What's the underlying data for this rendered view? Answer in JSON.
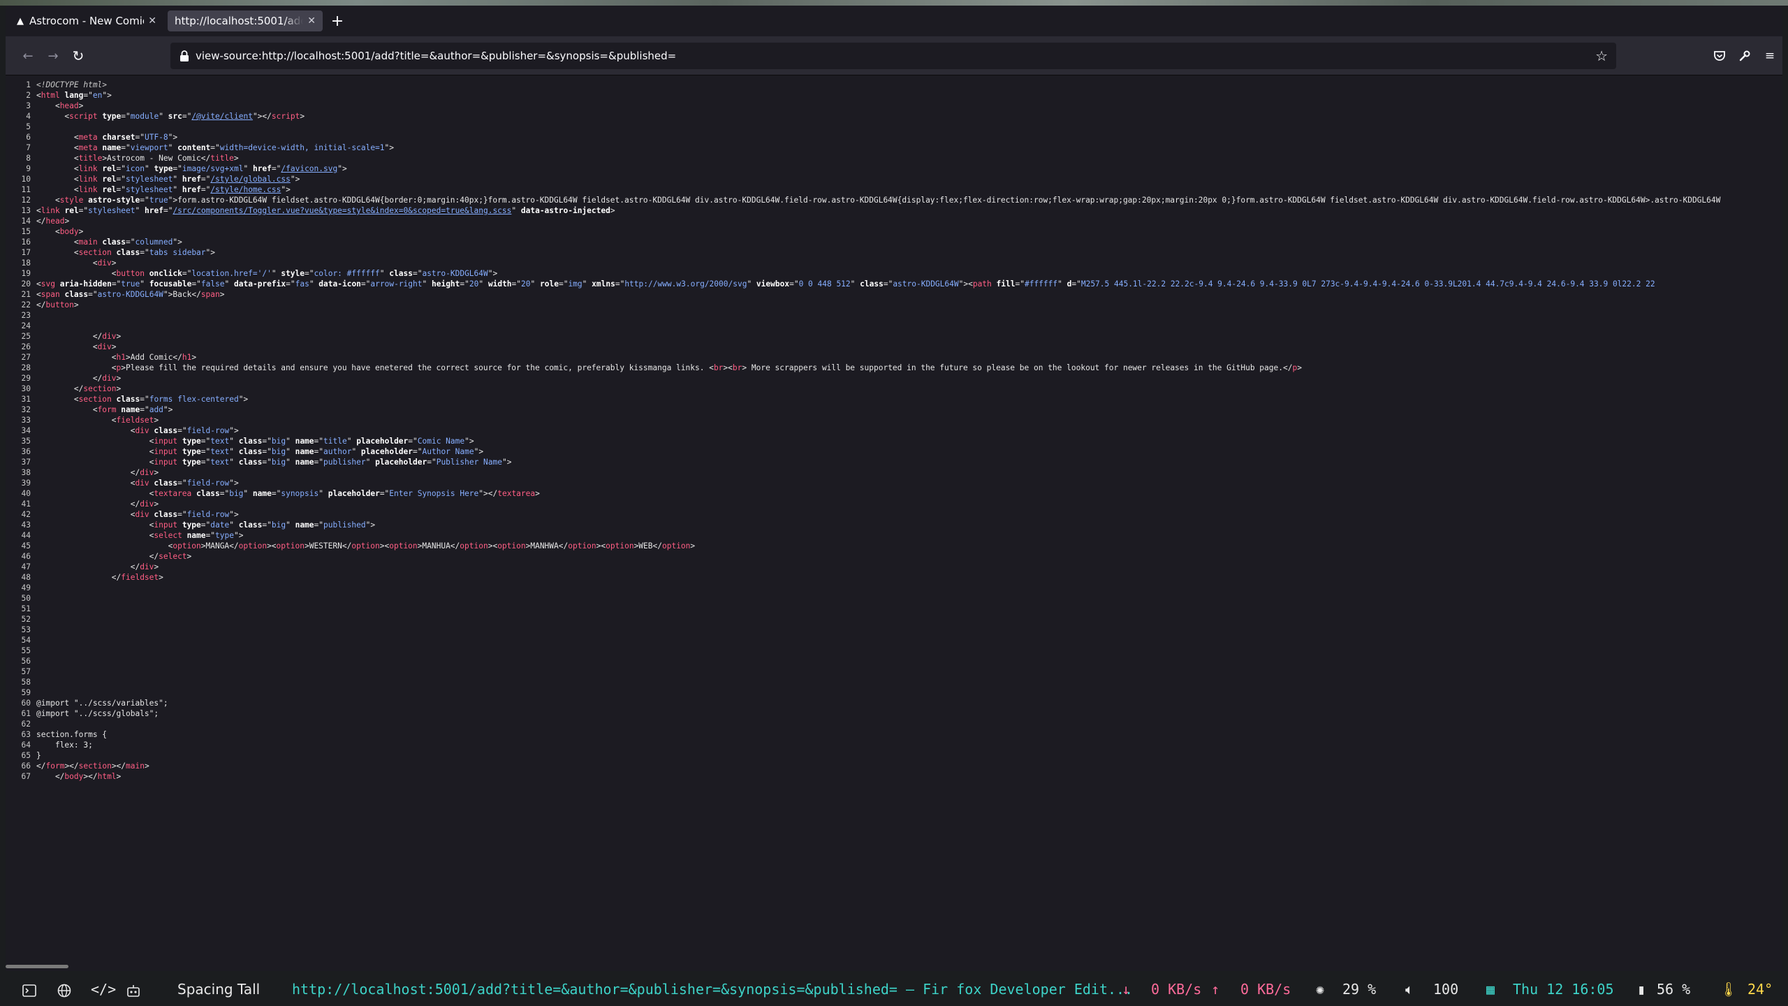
{
  "browser": {
    "tabs": [
      {
        "title": "Astrocom - New Comic",
        "favicon": "astro-logo-icon",
        "active": false
      },
      {
        "title": "http://localhost:5001/add?title=&author=&publisher=&synopsis=&published=",
        "favicon": "",
        "active": true
      }
    ],
    "url": "view-source:http://localhost:5001/add?title=&author=&publisher=&synopsis=&published=",
    "icons": [
      "back-icon",
      "forward-icon",
      "reload-icon",
      "lock-icon",
      "bookmark-star-icon",
      "pocket-icon",
      "devtools-icon",
      "menu-icon"
    ]
  },
  "source": {
    "lines": [
      {
        "n": 1,
        "html": "<span class=\"doc\">&lt;!DOCTYPE html&gt;</span>"
      },
      {
        "n": 2,
        "html": "&lt;<span class=\"tg\">html</span> <span class=\"a\">lang</span>=\"<span class=\"v\">en</span>\"&gt;"
      },
      {
        "n": 3,
        "html": "    &lt;<span class=\"tg\">head</span>&gt;"
      },
      {
        "n": 4,
        "html": "      &lt;<span class=\"tg\">script</span> <span class=\"a\">type</span>=\"<span class=\"v\">module</span>\" <span class=\"a\">src</span>=\"<span class=\"lnk\">/@vite/client</span>\"&gt;&lt;/<span class=\"tg\">script</span>&gt;"
      },
      {
        "n": 5,
        "html": ""
      },
      {
        "n": 6,
        "html": "        &lt;<span class=\"tg\">meta</span> <span class=\"a\">charset</span>=\"<span class=\"v\">UTF-8</span>\"&gt;"
      },
      {
        "n": 7,
        "html": "        &lt;<span class=\"tg\">meta</span> <span class=\"a\">name</span>=\"<span class=\"v\">viewport</span>\" <span class=\"a\">content</span>=\"<span class=\"v\">width=device-width, initial-scale=1</span>\"&gt;"
      },
      {
        "n": 8,
        "html": "        &lt;<span class=\"tg\">title</span>&gt;Astrocom - New Comic&lt;/<span class=\"tg\">title</span>&gt;"
      },
      {
        "n": 9,
        "html": "        &lt;<span class=\"tg\">link</span> <span class=\"a\">rel</span>=\"<span class=\"v\">icon</span>\" <span class=\"a\">type</span>=\"<span class=\"v\">image/svg+xml</span>\" <span class=\"a\">href</span>=\"<span class=\"lnk\">/favicon.svg</span>\"&gt;"
      },
      {
        "n": 10,
        "html": "        &lt;<span class=\"tg\">link</span> <span class=\"a\">rel</span>=\"<span class=\"v\">stylesheet</span>\" <span class=\"a\">href</span>=\"<span class=\"lnk\">/style/global.css</span>\"&gt;"
      },
      {
        "n": 11,
        "html": "        &lt;<span class=\"tg\">link</span> <span class=\"a\">rel</span>=\"<span class=\"v\">stylesheet</span>\" <span class=\"a\">href</span>=\"<span class=\"lnk\">/style/home.css</span>\"&gt;"
      },
      {
        "n": 12,
        "html": "    &lt;<span class=\"tg\">style</span> <span class=\"a\">astro-style</span>=\"<span class=\"v\">true</span>\"&gt;form.astro-KDDGL64W fieldset.astro-KDDGL64W{border:0;margin:40px;}form.astro-KDDGL64W fieldset.astro-KDDGL64W div.astro-KDDGL64W.field-row.astro-KDDGL64W{display:flex;flex-direction:row;flex-wrap:wrap;gap:20px;margin:20px 0;}form.astro-KDDGL64W fieldset.astro-KDDGL64W div.astro-KDDGL64W.field-row.astro-KDDGL64W&gt;.astro-KDDGL64W"
      },
      {
        "n": 13,
        "html": "&lt;<span class=\"tg\">link</span> <span class=\"a\">rel</span>=\"<span class=\"v\">stylesheet</span>\" <span class=\"a\">href</span>=\"<span class=\"lnk\">/src/components/Toggler.vue?vue&amp;type=style&amp;index=0&amp;scoped=true&amp;lang.scss</span>\" <span class=\"a\">data-astro-injected</span>&gt;"
      },
      {
        "n": 14,
        "html": "&lt;/<span class=\"tg\">head</span>&gt;"
      },
      {
        "n": 15,
        "html": "    &lt;<span class=\"tg\">body</span>&gt;"
      },
      {
        "n": 16,
        "html": "        &lt;<span class=\"tg\">main</span> <span class=\"a\">class</span>=\"<span class=\"v\">columned</span>\"&gt;"
      },
      {
        "n": 17,
        "html": "        &lt;<span class=\"tg\">section</span> <span class=\"a\">class</span>=\"<span class=\"v\">tabs sidebar</span>\"&gt;"
      },
      {
        "n": 18,
        "html": "            &lt;<span class=\"tg\">div</span>&gt;"
      },
      {
        "n": 19,
        "html": "                &lt;<span class=\"tg\">button</span> <span class=\"a\">onclick</span>=\"<span class=\"v\">location.href='/'</span>\" <span class=\"a\">style</span>=\"<span class=\"v\">color: #ffffff</span>\" <span class=\"a\">class</span>=\"<span class=\"v\">astro-KDDGL64W</span>\"&gt;"
      },
      {
        "n": 20,
        "html": "&lt;<span class=\"tg\">svg</span> <span class=\"a\">aria-hidden</span>=\"<span class=\"v\">true</span>\" <span class=\"a\">focusable</span>=\"<span class=\"v\">false</span>\" <span class=\"a\">data-prefix</span>=\"<span class=\"v\">fas</span>\" <span class=\"a\">data-icon</span>=\"<span class=\"v\">arrow-right</span>\" <span class=\"a\">height</span>=\"<span class=\"v\">20</span>\" <span class=\"a\">width</span>=\"<span class=\"v\">20</span>\" <span class=\"a\">role</span>=\"<span class=\"v\">img</span>\" <span class=\"a\">xmlns</span>=\"<span class=\"v\">http://www.w3.org/2000/svg</span>\" <span class=\"a\">viewbox</span>=\"<span class=\"v\">0 0 448 512</span>\" <span class=\"a\">class</span>=\"<span class=\"v\">astro-KDDGL64W</span>\"&gt;&lt;<span class=\"tg\">path</span> <span class=\"a\">fill</span>=\"<span class=\"v\">#ffffff</span>\" <span class=\"a\">d</span>=\"<span class=\"v\">M257.5 445.1l-22.2 22.2c-9.4 9.4-24.6 9.4-33.9 0L7 273c-9.4-9.4-9.4-24.6 0-33.9L201.4 44.7c9.4-9.4 24.6-9.4 33.9 0l22.2 22</span>"
      },
      {
        "n": 21,
        "html": "&lt;<span class=\"tg\">span</span> <span class=\"a\">class</span>=\"<span class=\"v\">astro-KDDGL64W</span>\"&gt;Back&lt;/<span class=\"tg\">span</span>&gt;"
      },
      {
        "n": 22,
        "html": "&lt;/<span class=\"tg\">button</span>&gt;"
      },
      {
        "n": 23,
        "html": ""
      },
      {
        "n": 24,
        "html": ""
      },
      {
        "n": 25,
        "html": "            &lt;/<span class=\"tg\">div</span>&gt;"
      },
      {
        "n": 26,
        "html": "            &lt;<span class=\"tg\">div</span>&gt;"
      },
      {
        "n": 27,
        "html": "                &lt;<span class=\"tg\">h1</span>&gt;Add Comic&lt;/<span class=\"tg\">h1</span>&gt;"
      },
      {
        "n": 28,
        "html": "                &lt;<span class=\"tg\">p</span>&gt;Please fill the required details and ensure you have enetered the correct source for the comic, preferably kissmanga links. &lt;<span class=\"tg\">br</span>&gt;&lt;<span class=\"tg\">br</span>&gt; More scrappers will be supported in the future so please be on the lookout for newer releases in the GitHub page.&lt;/<span class=\"tg\">p</span>&gt;"
      },
      {
        "n": 29,
        "html": "            &lt;/<span class=\"tg\">div</span>&gt;"
      },
      {
        "n": 30,
        "html": "        &lt;/<span class=\"tg\">section</span>&gt;"
      },
      {
        "n": 31,
        "html": "        &lt;<span class=\"tg\">section</span> <span class=\"a\">class</span>=\"<span class=\"v\">forms flex-centered</span>\"&gt;"
      },
      {
        "n": 32,
        "html": "            &lt;<span class=\"tg\">form</span> <span class=\"a\">name</span>=\"<span class=\"v\">add</span>\"&gt;"
      },
      {
        "n": 33,
        "html": "                &lt;<span class=\"tg\">fieldset</span>&gt;"
      },
      {
        "n": 34,
        "html": "                    &lt;<span class=\"tg\">div</span> <span class=\"a\">class</span>=\"<span class=\"v\">field-row</span>\"&gt;"
      },
      {
        "n": 35,
        "html": "                        &lt;<span class=\"tg\">input</span> <span class=\"a\">type</span>=\"<span class=\"v\">text</span>\" <span class=\"a\">class</span>=\"<span class=\"v\">big</span>\" <span class=\"a\">name</span>=\"<span class=\"v\">title</span>\" <span class=\"a\">placeholder</span>=\"<span class=\"v\">Comic Name</span>\"&gt;"
      },
      {
        "n": 36,
        "html": "                        &lt;<span class=\"tg\">input</span> <span class=\"a\">type</span>=\"<span class=\"v\">text</span>\" <span class=\"a\">class</span>=\"<span class=\"v\">big</span>\" <span class=\"a\">name</span>=\"<span class=\"v\">author</span>\" <span class=\"a\">placeholder</span>=\"<span class=\"v\">Author Name</span>\"&gt;"
      },
      {
        "n": 37,
        "html": "                        &lt;<span class=\"tg\">input</span> <span class=\"a\">type</span>=\"<span class=\"v\">text</span>\" <span class=\"a\">class</span>=\"<span class=\"v\">big</span>\" <span class=\"a\">name</span>=\"<span class=\"v\">publisher</span>\" <span class=\"a\">placeholder</span>=\"<span class=\"v\">Publisher Name</span>\"&gt;"
      },
      {
        "n": 38,
        "html": "                    &lt;/<span class=\"tg\">div</span>&gt;"
      },
      {
        "n": 39,
        "html": "                    &lt;<span class=\"tg\">div</span> <span class=\"a\">class</span>=\"<span class=\"v\">field-row</span>\"&gt;"
      },
      {
        "n": 40,
        "html": "                        &lt;<span class=\"tg\">textarea</span> <span class=\"a\">class</span>=\"<span class=\"v\">big</span>\" <span class=\"a\">name</span>=\"<span class=\"v\">synopsis</span>\" <span class=\"a\">placeholder</span>=\"<span class=\"v\">Enter Synopsis Here</span>\"&gt;&lt;/<span class=\"tg\">textarea</span>&gt;"
      },
      {
        "n": 41,
        "html": "                    &lt;/<span class=\"tg\">div</span>&gt;"
      },
      {
        "n": 42,
        "html": "                    &lt;<span class=\"tg\">div</span> <span class=\"a\">class</span>=\"<span class=\"v\">field-row</span>\"&gt;"
      },
      {
        "n": 43,
        "html": "                        &lt;<span class=\"tg\">input</span> <span class=\"a\">type</span>=\"<span class=\"v\">date</span>\" <span class=\"a\">class</span>=\"<span class=\"v\">big</span>\" <span class=\"a\">name</span>=\"<span class=\"v\">published</span>\"&gt;"
      },
      {
        "n": 44,
        "html": "                        &lt;<span class=\"tg\">select</span> <span class=\"a\">name</span>=\"<span class=\"v\">type</span>\"&gt;"
      },
      {
        "n": 45,
        "html": "                            &lt;<span class=\"tg\">option</span>&gt;MANGA&lt;/<span class=\"tg\">option</span>&gt;&lt;<span class=\"tg\">option</span>&gt;WESTERN&lt;/<span class=\"tg\">option</span>&gt;&lt;<span class=\"tg\">option</span>&gt;MANHUA&lt;/<span class=\"tg\">option</span>&gt;&lt;<span class=\"tg\">option</span>&gt;MANHWA&lt;/<span class=\"tg\">option</span>&gt;&lt;<span class=\"tg\">option</span>&gt;WEB&lt;/<span class=\"tg\">option</span>&gt;"
      },
      {
        "n": 46,
        "html": "                        &lt;/<span class=\"tg\">select</span>&gt;"
      },
      {
        "n": 47,
        "html": "                    &lt;/<span class=\"tg\">div</span>&gt;"
      },
      {
        "n": 48,
        "html": "                &lt;/<span class=\"tg\">fieldset</span>&gt;"
      },
      {
        "n": 49,
        "html": ""
      },
      {
        "n": 50,
        "html": ""
      },
      {
        "n": 51,
        "html": ""
      },
      {
        "n": 52,
        "html": ""
      },
      {
        "n": 53,
        "html": ""
      },
      {
        "n": 54,
        "html": ""
      },
      {
        "n": 55,
        "html": ""
      },
      {
        "n": 56,
        "html": ""
      },
      {
        "n": 57,
        "html": ""
      },
      {
        "n": 58,
        "html": ""
      },
      {
        "n": 59,
        "html": ""
      },
      {
        "n": 60,
        "html": "@import \"../scss/variables\";"
      },
      {
        "n": 61,
        "html": "@import \"../scss/globals\";"
      },
      {
        "n": 62,
        "html": ""
      },
      {
        "n": 63,
        "html": "section.forms {"
      },
      {
        "n": 64,
        "html": "    flex: 3;"
      },
      {
        "n": 65,
        "html": "}"
      },
      {
        "n": 66,
        "html": "&lt;/<span class=\"tg\">form</span>&gt;&lt;/<span class=\"tg\">section</span>&gt;&lt;/<span class=\"tg\">main</span>&gt;"
      },
      {
        "n": 67,
        "html": "    &lt;/<span class=\"tg\">body</span>&gt;&lt;/<span class=\"tg\">html</span>&gt;"
      }
    ]
  },
  "statusbar": {
    "layout": "Spacing Tall",
    "window_title": "http://localhost:5001/add?title=&author=&publisher=&synopsis=&published= — Fir fox Developer Edit...",
    "net_down": "0 KB/s",
    "net_up": "0 KB/s",
    "brightness": "29 %",
    "volume": "100",
    "datetime": "Thu 12 16:05",
    "battery": "56 %",
    "temperature": "24°",
    "colors": {
      "title": "#3dd2c7",
      "network": "#ff6b9a",
      "temperature": "#ffd84a"
    }
  }
}
